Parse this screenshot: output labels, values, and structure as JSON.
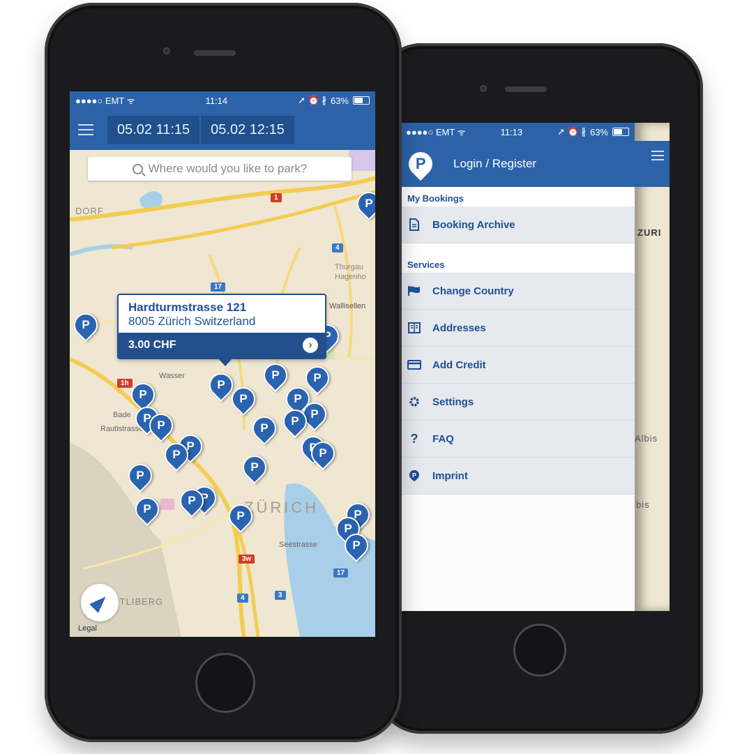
{
  "left_phone": {
    "status": {
      "carrier": "●●●●○ EMT",
      "wifi": "ᯤ",
      "time": "11:14",
      "icons": "➚ ⏰ ∦",
      "battery": "63%",
      "battery_level": 0.63
    },
    "navbar": {
      "start": "05.02 11:15",
      "end": "05.02 12:15"
    },
    "search": {
      "placeholder": "Where would you like to park?"
    },
    "callout": {
      "street": "Hardturmstrasse 121",
      "city": "8005 Zürich Switzerland",
      "price": "3.00 CHF",
      "go": "›"
    },
    "pin_label": "P",
    "map_labels": {
      "dorf": "DORF",
      "zurich": "ZÜRICH",
      "uetliberg": "ETLIBERG",
      "thurgau": "Thurgau",
      "hagenho": "Hagenho",
      "wallisellen": "Wallisellen",
      "wasser": "Wasser",
      "rautistrasse": "Rautistrasse",
      "seestrasse": "Seestrasse",
      "bader": "Bade",
      "legal": "Legal"
    },
    "shields": {
      "s1": "1",
      "s4": "4",
      "s17": "17",
      "s1h": "1h",
      "s3w": "3w",
      "s17b": "17",
      "s4b": "4",
      "s3": "3"
    }
  },
  "right_phone": {
    "status": {
      "carrier": "●●●●○ EMT",
      "wifi": "ᯤ",
      "time": "11:13",
      "icons": "➚ ⏰ ∦",
      "battery": "63%",
      "battery_level": 0.63
    },
    "header": {
      "logo": "P",
      "login": "Login / Register"
    },
    "sections": [
      {
        "title": "My Bookings",
        "items": [
          {
            "label": "Booking Archive",
            "icon": "document-icon"
          }
        ]
      },
      {
        "title": "Services",
        "items": [
          {
            "label": "Change Country",
            "icon": "flag-icon"
          },
          {
            "label": "Addresses",
            "icon": "address-book-icon"
          },
          {
            "label": "Add Credit",
            "icon": "credit-card-icon"
          },
          {
            "label": "Settings",
            "icon": "gear-icon"
          },
          {
            "label": "FAQ",
            "icon": "question-icon"
          },
          {
            "label": "Imprint",
            "icon": "p-pin-icon"
          }
        ]
      }
    ],
    "underlay_labels": {
      "zuri": "ZURI",
      "albis": "Albis",
      "bis": "bis"
    }
  },
  "colors": {
    "brand_blue": "#2c63a8",
    "dark_blue": "#234f8f",
    "map_bg": "#efe7d2",
    "lake": "#a9cfe8",
    "road": "#f4cc53"
  }
}
